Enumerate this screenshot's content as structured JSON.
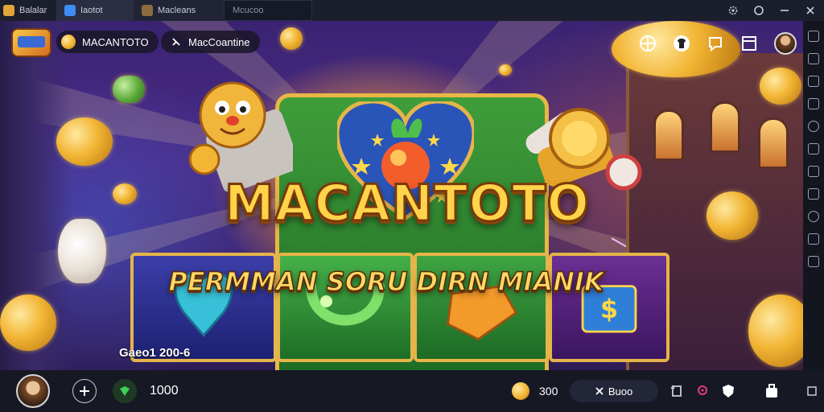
{
  "titlebar": {
    "tabs": [
      {
        "label": "Balalar",
        "icon": "app-grid-icon",
        "color": "#e0a43a"
      },
      {
        "label": "Iaotot",
        "icon": "blue-app-icon",
        "color": "#3d8df5"
      },
      {
        "label": "Macleans",
        "icon": "game-thumbnail-icon",
        "color": "#8b6d3c"
      },
      {
        "label": "Mcucoo",
        "icon": "",
        "color": "#2a2e42"
      }
    ],
    "controls": [
      "settings-icon",
      "circle-icon",
      "minimize-icon",
      "close-icon"
    ]
  },
  "hud": {
    "game_name": "MACANTOTO",
    "mode_label": "MacCoantine"
  },
  "game": {
    "title": "MACANTOTO",
    "subtitle": "PERMMAN SORU DIRN MIANIK",
    "score_line": "Gaeo1 200-6"
  },
  "bottombar": {
    "balance": "1000",
    "coins": "300",
    "action_label": "Buoo"
  },
  "colors": {
    "title_gold": "#ffd44a",
    "frame_gold": "#e5b44a",
    "board_green": "#3f9d3a",
    "bg_purple": "#3a2372"
  }
}
